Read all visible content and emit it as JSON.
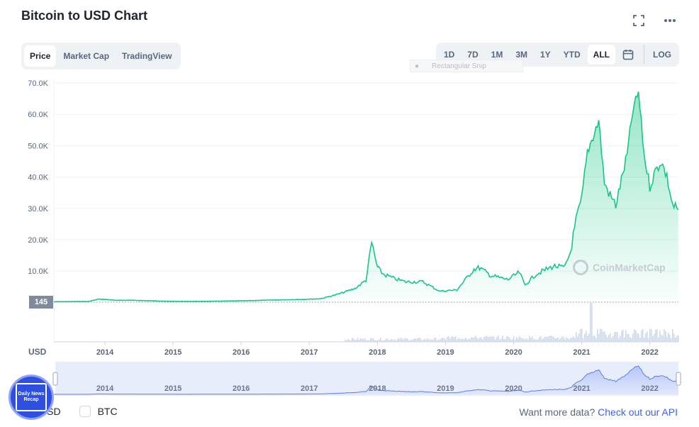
{
  "header": {
    "title": "Bitcoin to USD Chart"
  },
  "toolbar": {
    "expand_icon": "fullscreen-icon",
    "more_icon": "more-horizontal-icon"
  },
  "tabs": [
    {
      "label": "Price",
      "active": true
    },
    {
      "label": "Market Cap",
      "active": false
    },
    {
      "label": "TradingView",
      "active": false
    }
  ],
  "ranges": [
    {
      "label": "1D"
    },
    {
      "label": "7D"
    },
    {
      "label": "1M"
    },
    {
      "label": "3M"
    },
    {
      "label": "1Y"
    },
    {
      "label": "YTD"
    },
    {
      "label": "ALL",
      "active": true
    }
  ],
  "log_label": "LOG",
  "overlay": {
    "snip_label": "Rectangular Snip"
  },
  "price_marker": "145",
  "watermark": "CoinMarketCap",
  "currency_axis_label": "USD",
  "legend": [
    {
      "label": "USD",
      "checked": true
    },
    {
      "label": "BTC",
      "checked": false
    }
  ],
  "api": {
    "text": "Want more data?",
    "link": "Check out our API"
  },
  "badge": {
    "text": "Daily News Recap"
  },
  "colors": {
    "line": "#16c784",
    "accent": "#3861fb",
    "nav_line": "#5b7cf0"
  },
  "chart_data": {
    "type": "area",
    "ylabel": "",
    "yticks": [
      "70.0K",
      "60.0K",
      "50.0K",
      "40.0K",
      "30.0K",
      "20.0K",
      "10.0K"
    ],
    "ylim": [
      0,
      70000
    ],
    "xticks": [
      "2014",
      "2015",
      "2016",
      "2017",
      "2018",
      "2019",
      "2020",
      "2021",
      "2022"
    ],
    "grid": true,
    "series": [
      {
        "x": [
          "2013-04",
          "2013-10",
          "2013-12",
          "2014-03",
          "2014-06",
          "2015-01",
          "2015-06",
          "2016-01",
          "2016-06",
          "2016-12",
          "2017-03",
          "2017-06",
          "2017-09",
          "2017-11",
          "2017-12",
          "2018-01",
          "2018-02",
          "2018-04",
          "2018-06",
          "2018-09",
          "2018-11",
          "2018-12",
          "2019-03",
          "2019-06",
          "2019-07",
          "2019-09",
          "2019-12",
          "2020-02",
          "2020-03",
          "2020-05",
          "2020-08",
          "2020-10",
          "2020-11",
          "2020-12",
          "2021-01",
          "2021-02",
          "2021-04",
          "2021-05",
          "2021-06",
          "2021-07",
          "2021-09",
          "2021-10",
          "2021-11",
          "2021-12",
          "2022-01",
          "2022-02",
          "2022-03",
          "2022-04",
          "2022-05",
          "2022-06"
        ],
        "y": [
          145,
          200,
          1000,
          600,
          600,
          250,
          250,
          430,
          650,
          900,
          1100,
          2500,
          4300,
          7000,
          19000,
          11000,
          9000,
          7500,
          6500,
          6500,
          4500,
          3500,
          3900,
          10500,
          11000,
          8500,
          7200,
          9500,
          5500,
          9000,
          11500,
          11000,
          16000,
          26000,
          33000,
          48000,
          58000,
          38000,
          34000,
          31000,
          47000,
          61000,
          67000,
          47000,
          37000,
          42000,
          45000,
          40000,
          31000,
          29500
        ]
      }
    ],
    "volume": true,
    "navigator_xticks": [
      "2014",
      "2015",
      "2016",
      "2017",
      "2018",
      "2019",
      "2020",
      "2021",
      "2022"
    ]
  }
}
